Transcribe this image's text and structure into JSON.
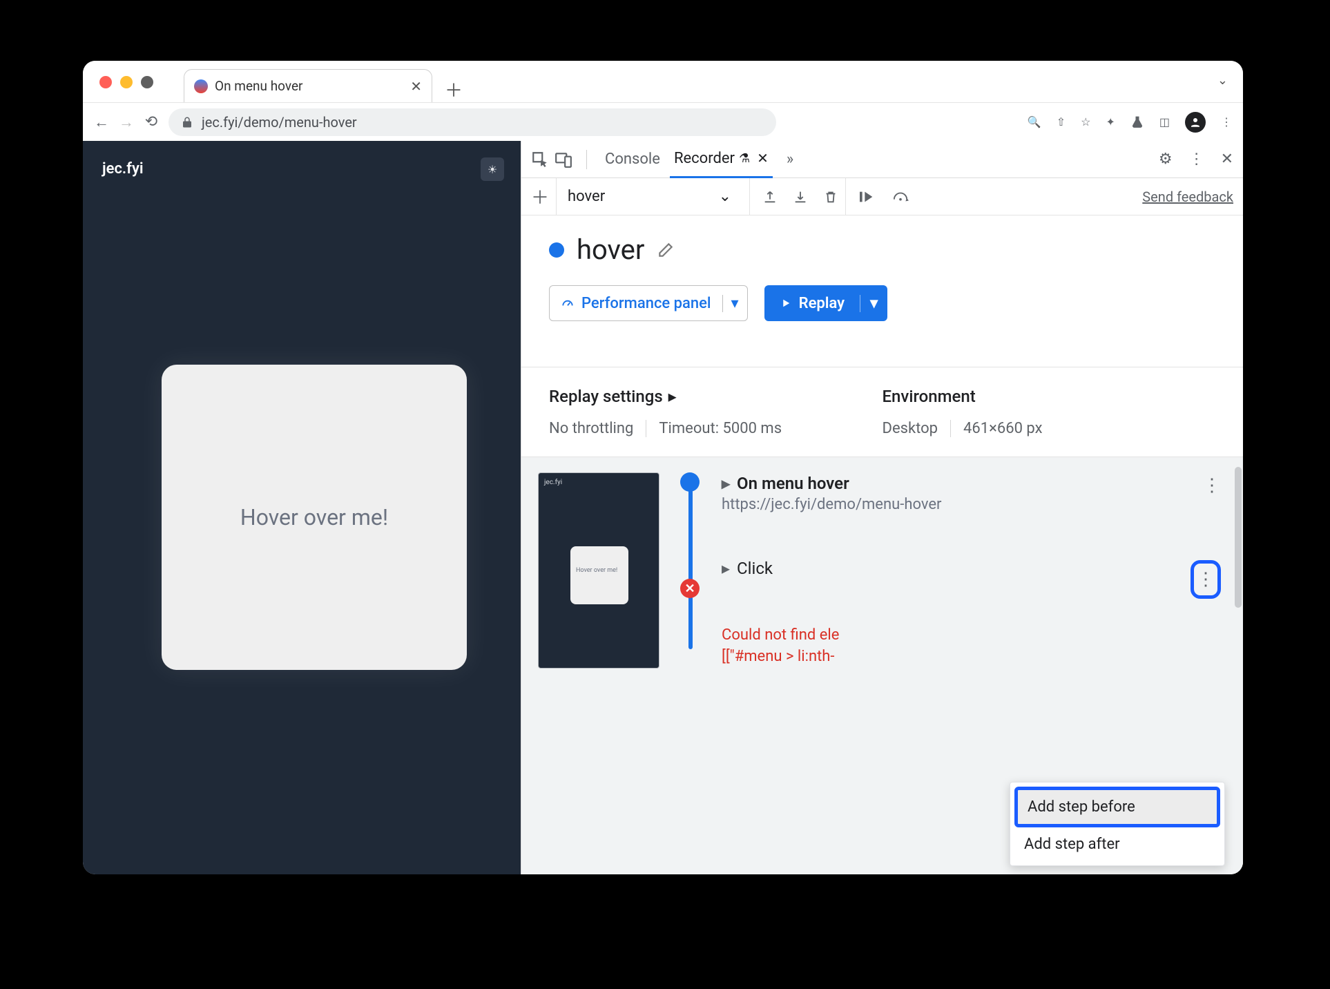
{
  "browser": {
    "tab_title": "On menu hover",
    "url": "jec.fyi/demo/menu-hover"
  },
  "page": {
    "brand": "jec.fyi",
    "card_text": "Hover over me!"
  },
  "devtools": {
    "tabs": {
      "console": "Console",
      "recorder": "Recorder"
    },
    "toolbar": {
      "recording_select": "hover",
      "feedback": "Send feedback"
    },
    "recording_name": "hover",
    "perf_button": "Performance panel",
    "replay_button": "Replay",
    "settings": {
      "replay_heading": "Replay settings",
      "throttling": "No throttling",
      "timeout": "Timeout: 5000 ms",
      "env_heading": "Environment",
      "device": "Desktop",
      "viewport": "461×660 px"
    },
    "steps": {
      "thumb_brand": "jec.fyi",
      "thumb_card": "Hover over me!",
      "step1_title": "On menu hover",
      "step1_url": "https://jec.fyi/demo/menu-hover",
      "step2_title": "Click",
      "error_line1": "Could not find ele",
      "error_line2": "[[\"#menu > li:nth-"
    },
    "context_menu": {
      "before": "Add step before",
      "after": "Add step after"
    }
  }
}
